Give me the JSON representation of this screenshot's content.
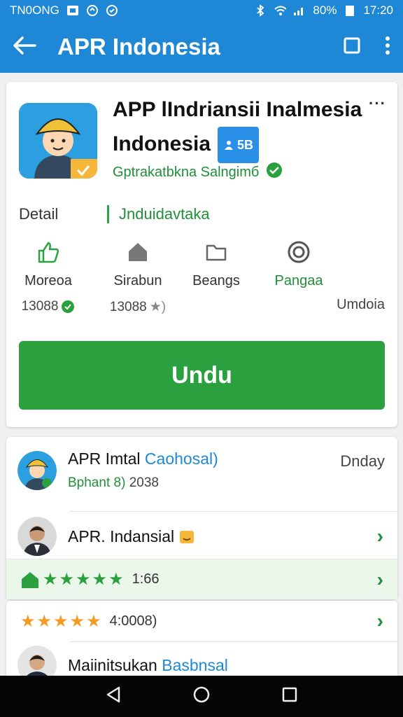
{
  "status_bar": {
    "carrier": "TN0ONG",
    "battery": "80%",
    "time": "17:20"
  },
  "app_bar": {
    "title": "APR Indonesia",
    "icons": [
      "back-arrow-icon",
      "square-icon",
      "overflow-menu-icon"
    ]
  },
  "app_card": {
    "name_line1": "APP lIndriansii Inalmesia",
    "name_line2": "Indonesia",
    "badge_label": "5B",
    "developer": "Gptrakatbkna Salngimб",
    "detail_label": "Detail",
    "detail_value": "Jnduidavtaka",
    "stats": [
      {
        "icon": "thumbs-up-icon",
        "label": "Moreoa",
        "value": "13088"
      },
      {
        "icon": "home-icon",
        "label": "Sirabun",
        "value": "13088"
      },
      {
        "icon": "folder-icon",
        "label": "Beangs",
        "value": ""
      },
      {
        "icon": "whatsapp-icon",
        "label": "Pangaa",
        "value": ""
      }
    ],
    "stat_extra": "Umdoia",
    "download_label": "Undu"
  },
  "list_card": {
    "item1": {
      "title": "APR Imtal",
      "title_accent": "Caohosal)",
      "subtitle": "Bphant 8)",
      "subtitle_num": "2038",
      "meta": "Dnday"
    },
    "item2": {
      "title": "APR. Indansial"
    },
    "rating1": {
      "text": "1:66"
    }
  },
  "list_card2": {
    "rating2": {
      "text": "4:0008)"
    },
    "item3": {
      "title": "Maiinitsukan",
      "title_accent": "Basbnsal"
    }
  },
  "colors": {
    "primary": "#1e88d6",
    "green": "#2aa13e",
    "orange": "#f59a23"
  }
}
